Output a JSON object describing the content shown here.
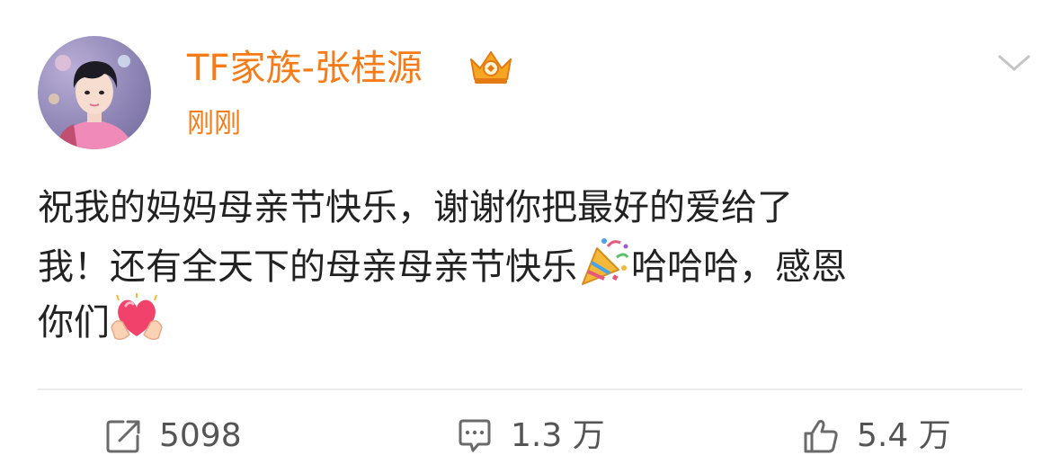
{
  "post": {
    "author": {
      "name": "TF家族-张桂源",
      "badge_icon": "crown-badge-icon",
      "accent_color": "#f77b17"
    },
    "timestamp": "刚刚",
    "text": {
      "line1": "祝我的妈妈母亲节快乐，谢谢你把最好的爱给了",
      "line2_before": "我！还有全天下的母亲母亲节快乐",
      "line2_emoji": "party-popper-icon",
      "line2_after": "哈哈哈，感恩",
      "line3_before": "你们",
      "line3_emoji": "heart-hands-icon"
    }
  },
  "actions": {
    "repost_count": "5098",
    "comment_count": "1.3 万",
    "like_count": "5.4 万"
  }
}
